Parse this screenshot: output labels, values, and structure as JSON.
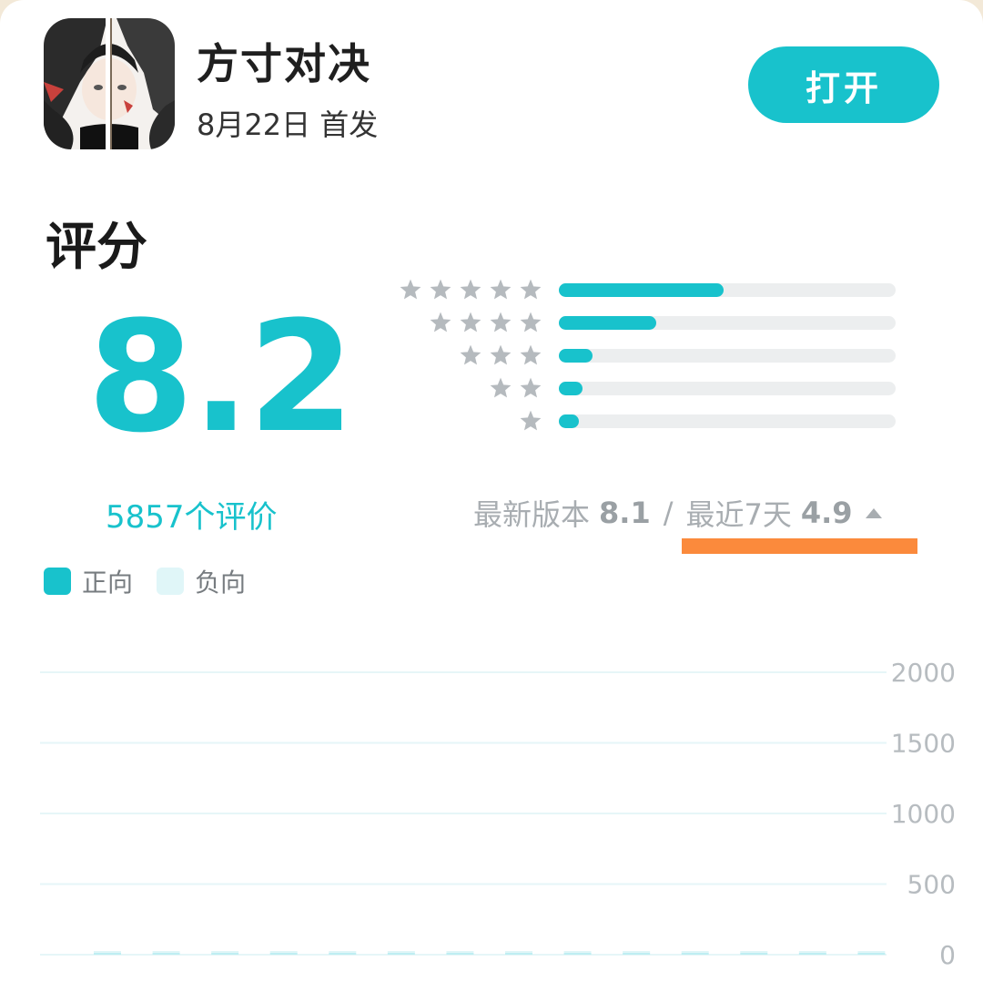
{
  "app": {
    "name": "方寸对决",
    "release": "8月22日 首发",
    "open_label": "打开"
  },
  "rating": {
    "title": "评分",
    "score": "8.2",
    "review_count": "5857个评价",
    "distribution": [
      {
        "stars": 5,
        "fraction": 0.49
      },
      {
        "stars": 4,
        "fraction": 0.29
      },
      {
        "stars": 3,
        "fraction": 0.1
      },
      {
        "stars": 2,
        "fraction": 0.07
      },
      {
        "stars": 1,
        "fraction": 0.06
      }
    ],
    "latest_version_label": "最新版本",
    "latest_version_score": "8.1",
    "separator": "/",
    "recent_label": "最近7天",
    "recent_score": "4.9",
    "recent_trend_icon": "triangle-up-icon"
  },
  "legend": {
    "positive": "正向",
    "negative": "负向",
    "positive_color": "#18c2cc",
    "negative_color": "#e0f6f8"
  },
  "colors": {
    "accent": "#18c2cc",
    "highlight": "#fb8a3c",
    "track": "#eceeef",
    "star": "#b5babe"
  },
  "chart_data": {
    "type": "bar",
    "series": [
      {
        "name": "正向",
        "values": [
          5,
          5,
          5,
          5,
          5,
          5,
          5,
          5,
          5,
          5,
          5,
          5,
          5,
          5
        ]
      },
      {
        "name": "负向",
        "values": [
          2,
          2,
          2,
          2,
          12,
          2,
          2,
          2,
          2,
          2,
          2,
          2,
          2,
          10
        ]
      }
    ],
    "ylim": [
      0,
      2000
    ],
    "yticks": [
      "2000",
      "1500",
      "1000",
      "500",
      "0"
    ],
    "grid": true
  }
}
